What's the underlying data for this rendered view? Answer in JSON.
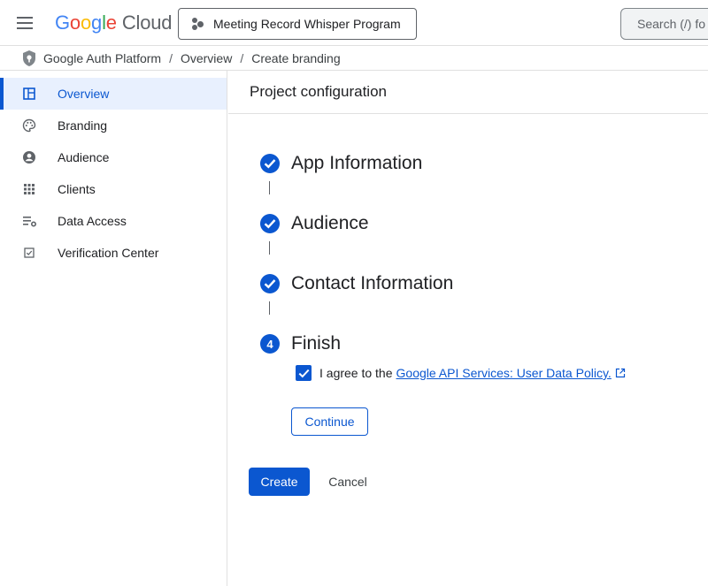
{
  "header": {
    "logo_google": [
      "G",
      "o",
      "o",
      "g",
      "l",
      "e"
    ],
    "logo_cloud": "Cloud",
    "project_name": "Meeting Record Whisper Program",
    "search_placeholder": "Search (/) fo"
  },
  "breadcrumb": {
    "items": [
      "Google Auth Platform",
      "Overview",
      "Create branding"
    ],
    "separator": "/"
  },
  "sidebar": {
    "items": [
      {
        "label": "Overview",
        "icon": "dashboard-icon",
        "active": true
      },
      {
        "label": "Branding",
        "icon": "palette-icon"
      },
      {
        "label": "Audience",
        "icon": "account-circle-icon"
      },
      {
        "label": "Clients",
        "icon": "apps-grid-icon"
      },
      {
        "label": "Data Access",
        "icon": "data-settings-icon"
      },
      {
        "label": "Verification Center",
        "icon": "checkbox-icon"
      }
    ]
  },
  "main": {
    "title": "Project configuration",
    "steps": [
      {
        "title": "App Information",
        "status": "complete"
      },
      {
        "title": "Audience",
        "status": "complete"
      },
      {
        "title": "Contact Information",
        "status": "complete"
      },
      {
        "title": "Finish",
        "status": "current",
        "number": "4"
      }
    ],
    "agree_text": "I agree to the",
    "agree_link": "Google API Services: User Data Policy.",
    "agree_checked": true,
    "continue_label": "Continue",
    "create_label": "Create",
    "cancel_label": "Cancel"
  },
  "colors": {
    "accent": "#0b57d0",
    "active_bg": "#e8f0fe"
  }
}
